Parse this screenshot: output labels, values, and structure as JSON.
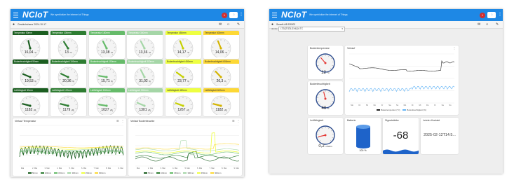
{
  "left": {
    "brand": "NCIoT",
    "tagline": "We symbiotize the internet of Things",
    "badge": "1",
    "button": "□",
    "sub_text": "Gewächshaus 2024-10-17",
    "row1": [
      {
        "title": "Temperatur 50mm",
        "value": "16,04",
        "unit": "°C",
        "head": "#1b5e20",
        "headText": "#ffffff",
        "needle": "#1b5e20",
        "level": 0.45
      },
      {
        "title": "Temperatur 100mm",
        "value": "13",
        "unit": "°C",
        "head": "#2e7d32",
        "headText": "#ffffff",
        "needle": "#2e7d32",
        "level": 0.38
      },
      {
        "title": "Temperatur 150mm",
        "value": "13,38",
        "unit": "°C",
        "head": "#66bb6a",
        "headText": "#ffffff",
        "needle": "#66bb6a",
        "level": 0.4
      },
      {
        "title": "Temperatur 300mm",
        "value": "13,36",
        "unit": "°C",
        "head": "#a5d6a7",
        "headText": "#ffffff",
        "needle": "#a5d6a7",
        "level": 0.4
      },
      {
        "title": "Temperatur 450mm",
        "value": "14,17",
        "unit": "°C",
        "head": "#eeff41",
        "headText": "#333333",
        "needle": "#c6d000",
        "level": 0.42
      },
      {
        "title": "Temperatur 600mm",
        "value": "14,06",
        "unit": "°C",
        "head": "#fdd835",
        "headText": "#333333",
        "needle": "#d4b400",
        "level": 0.42
      }
    ],
    "row2": [
      {
        "title": "Bodenfeuchtigkeit 50mm",
        "value": "19,53",
        "unit": "%",
        "head": "#1b5e20",
        "headText": "#ffffff",
        "needle": "#1b5e20",
        "level": 0.25
      },
      {
        "title": "Bodenfeuchtigkeit 100mm",
        "value": "20,36",
        "unit": "%",
        "head": "#2e7d32",
        "headText": "#ffffff",
        "needle": "#2e7d32",
        "level": 0.26
      },
      {
        "title": "Bodenfeuchtigkeit 150mm",
        "value": "15,71",
        "unit": "%",
        "head": "#66bb6a",
        "headText": "#ffffff",
        "needle": "#66bb6a",
        "level": 0.2
      },
      {
        "title": "Bodenfeuchtigkeit 300mm",
        "value": "31,02",
        "unit": "%",
        "head": "#a5d6a7",
        "headText": "#ffffff",
        "needle": "#a5d6a7",
        "level": 0.4
      },
      {
        "title": "Bodenfeuchtigkeit 450mm",
        "value": "23,77",
        "unit": "%",
        "head": "#eeff41",
        "headText": "#333333",
        "needle": "#c6d000",
        "level": 0.3
      },
      {
        "title": "Bodenfeuchtigkeit 600mm",
        "value": "26,3",
        "unit": "%",
        "head": "#fdd835",
        "headText": "#333333",
        "needle": "#d4b400",
        "level": 0.34
      }
    ],
    "row3": [
      {
        "title": "Leitfähigkeit 50mm",
        "value": "1182",
        "unit": "µS",
        "head": "#1b5e20",
        "headText": "#ffffff",
        "needle": "#1b5e20",
        "level": 0.22
      },
      {
        "title": "Leitfähigkeit 100mm",
        "value": "1179",
        "unit": "µS",
        "head": "#2e7d32",
        "headText": "#ffffff",
        "needle": "#2e7d32",
        "level": 0.22
      },
      {
        "title": "Leitfähigkeit 150mm",
        "value": "1027",
        "unit": "µS",
        "head": "#66bb6a",
        "headText": "#ffffff",
        "needle": "#66bb6a",
        "level": 0.2
      },
      {
        "title": "Leitfähigkeit 300mm",
        "value": "1301",
        "unit": "µS",
        "head": "#a5d6a7",
        "headText": "#ffffff",
        "needle": "#a5d6a7",
        "level": 0.25
      },
      {
        "title": "Leitfähigkeit 450mm",
        "value": "1267",
        "unit": "µS",
        "head": "#eeff41",
        "headText": "#333333",
        "needle": "#c6d000",
        "level": 0.24
      },
      {
        "title": "Leitfähigkeit 600mm",
        "value": "1182",
        "unit": "µS",
        "head": "#fdd835",
        "headText": "#333333",
        "needle": "#d4b400",
        "level": 0.22
      }
    ],
    "chart1_title": "Verlauf Temperatur",
    "chart2_title": "Verlauf Bodenfeuchte",
    "legend": [
      "50mm",
      "100mm",
      "150mm",
      "300mm",
      "450mm",
      "600mm"
    ],
    "legend_colors": [
      "#1b5e20",
      "#2e7d32",
      "#66bb6a",
      "#a5d6a7",
      "#eeff41",
      "#fdd835"
    ],
    "xticks": [
      "Mai",
      "2. Mai",
      "3. Mai",
      "4. Mai",
      "5. Mai",
      "6. Mai",
      "7. Mai",
      "8. Mai",
      "9. Mai"
    ]
  },
  "right": {
    "brand": "NCIoT",
    "tagline": "We symbiotize the internet of Things",
    "badge": "1",
    "sub_text": "SmartLAB D5302",
    "select_label": "device",
    "select_value": "LT2QTIZ3LDX4QV-TC",
    "gauge1_title": "Bodentemperatur",
    "gauge1_value": "12",
    "gauge1_unit": "°C",
    "gauge1_level": 0.35,
    "gauge2_title": "Bodenfeuchtigkeit",
    "gauge2_value": "40",
    "gauge2_unit": "%",
    "gauge2_level": 0.45,
    "gauge3_title": "Leitfähigkeit",
    "gauge3_value": "0,2",
    "gauge3_unit": "mS/cm",
    "gauge3_level": 0.12,
    "chart_title": "Verlauf",
    "legend": [
      "Bodentemperatur (°C)",
      "Bodenfeuchtigkeit (%)"
    ],
    "legend_colors": [
      "#222222",
      "#64b5f6"
    ],
    "xticks": [
      "Mo",
      "Di",
      "Mi",
      "Do",
      "Fr",
      "Sa",
      "So",
      "Mo",
      "Di",
      "Mi",
      "Do",
      "Fr",
      "Sa",
      "So"
    ],
    "battery_title": "Batterie",
    "battery_value": "100",
    "battery_unit": "%",
    "signal_title": "Signalstärke",
    "signal_value": "-68",
    "last_title": "Letzter Kontakt",
    "last_value": "2025-02-12T14:5..."
  }
}
